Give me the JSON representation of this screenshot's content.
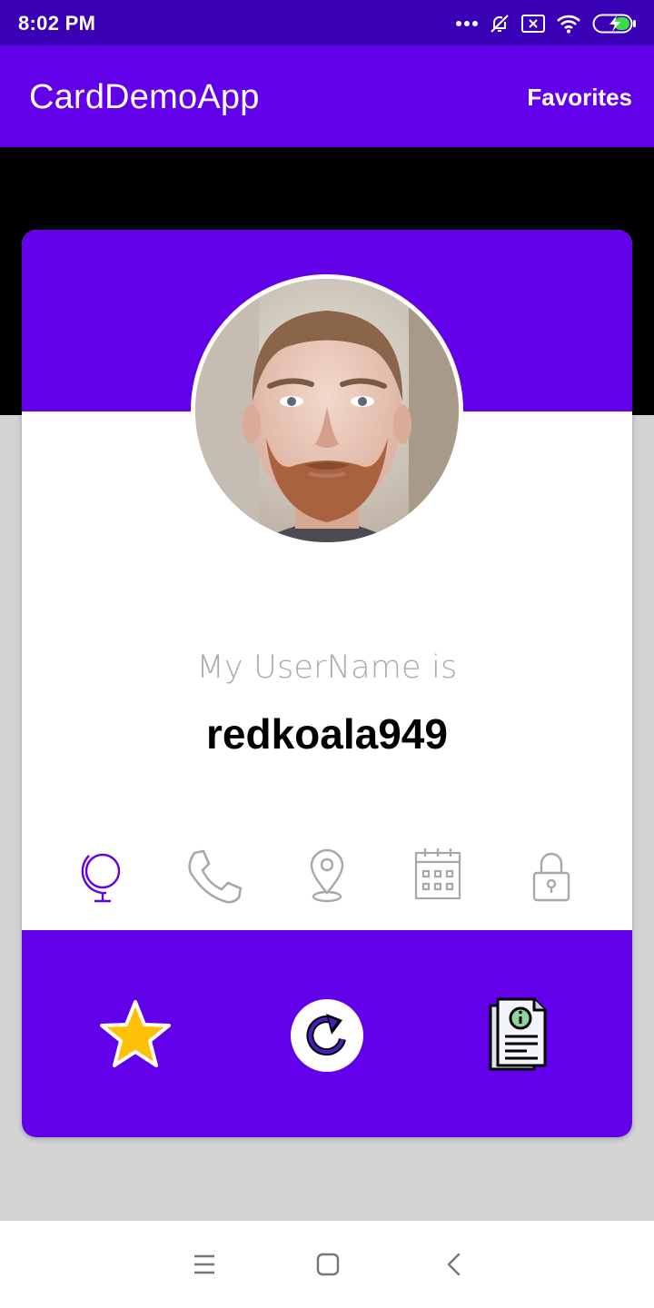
{
  "status_bar": {
    "time": "8:02 PM",
    "icons": [
      "more-dots-icon",
      "notifications-off-icon",
      "sim-x-icon",
      "wifi-icon",
      "battery-charging-icon"
    ]
  },
  "app_bar": {
    "title": "CardDemoApp",
    "action_label": "Favorites"
  },
  "card": {
    "username_caption": "My UserName is",
    "username": "redkoala949",
    "info_icons": [
      "globe-icon",
      "phone-icon",
      "location-pin-icon",
      "calendar-icon",
      "lock-icon"
    ],
    "active_info_icon": "globe-icon",
    "actions": [
      "favorite-star-icon",
      "refresh-icon",
      "details-document-icon"
    ]
  },
  "nav_bar": {
    "buttons": [
      "menu-icon",
      "home-icon",
      "back-icon"
    ]
  },
  "colors": {
    "status_bar": "#3a00b6",
    "primary": "#6200ea",
    "star": "#ffc107",
    "inactive_icon": "#a8a8a8"
  }
}
